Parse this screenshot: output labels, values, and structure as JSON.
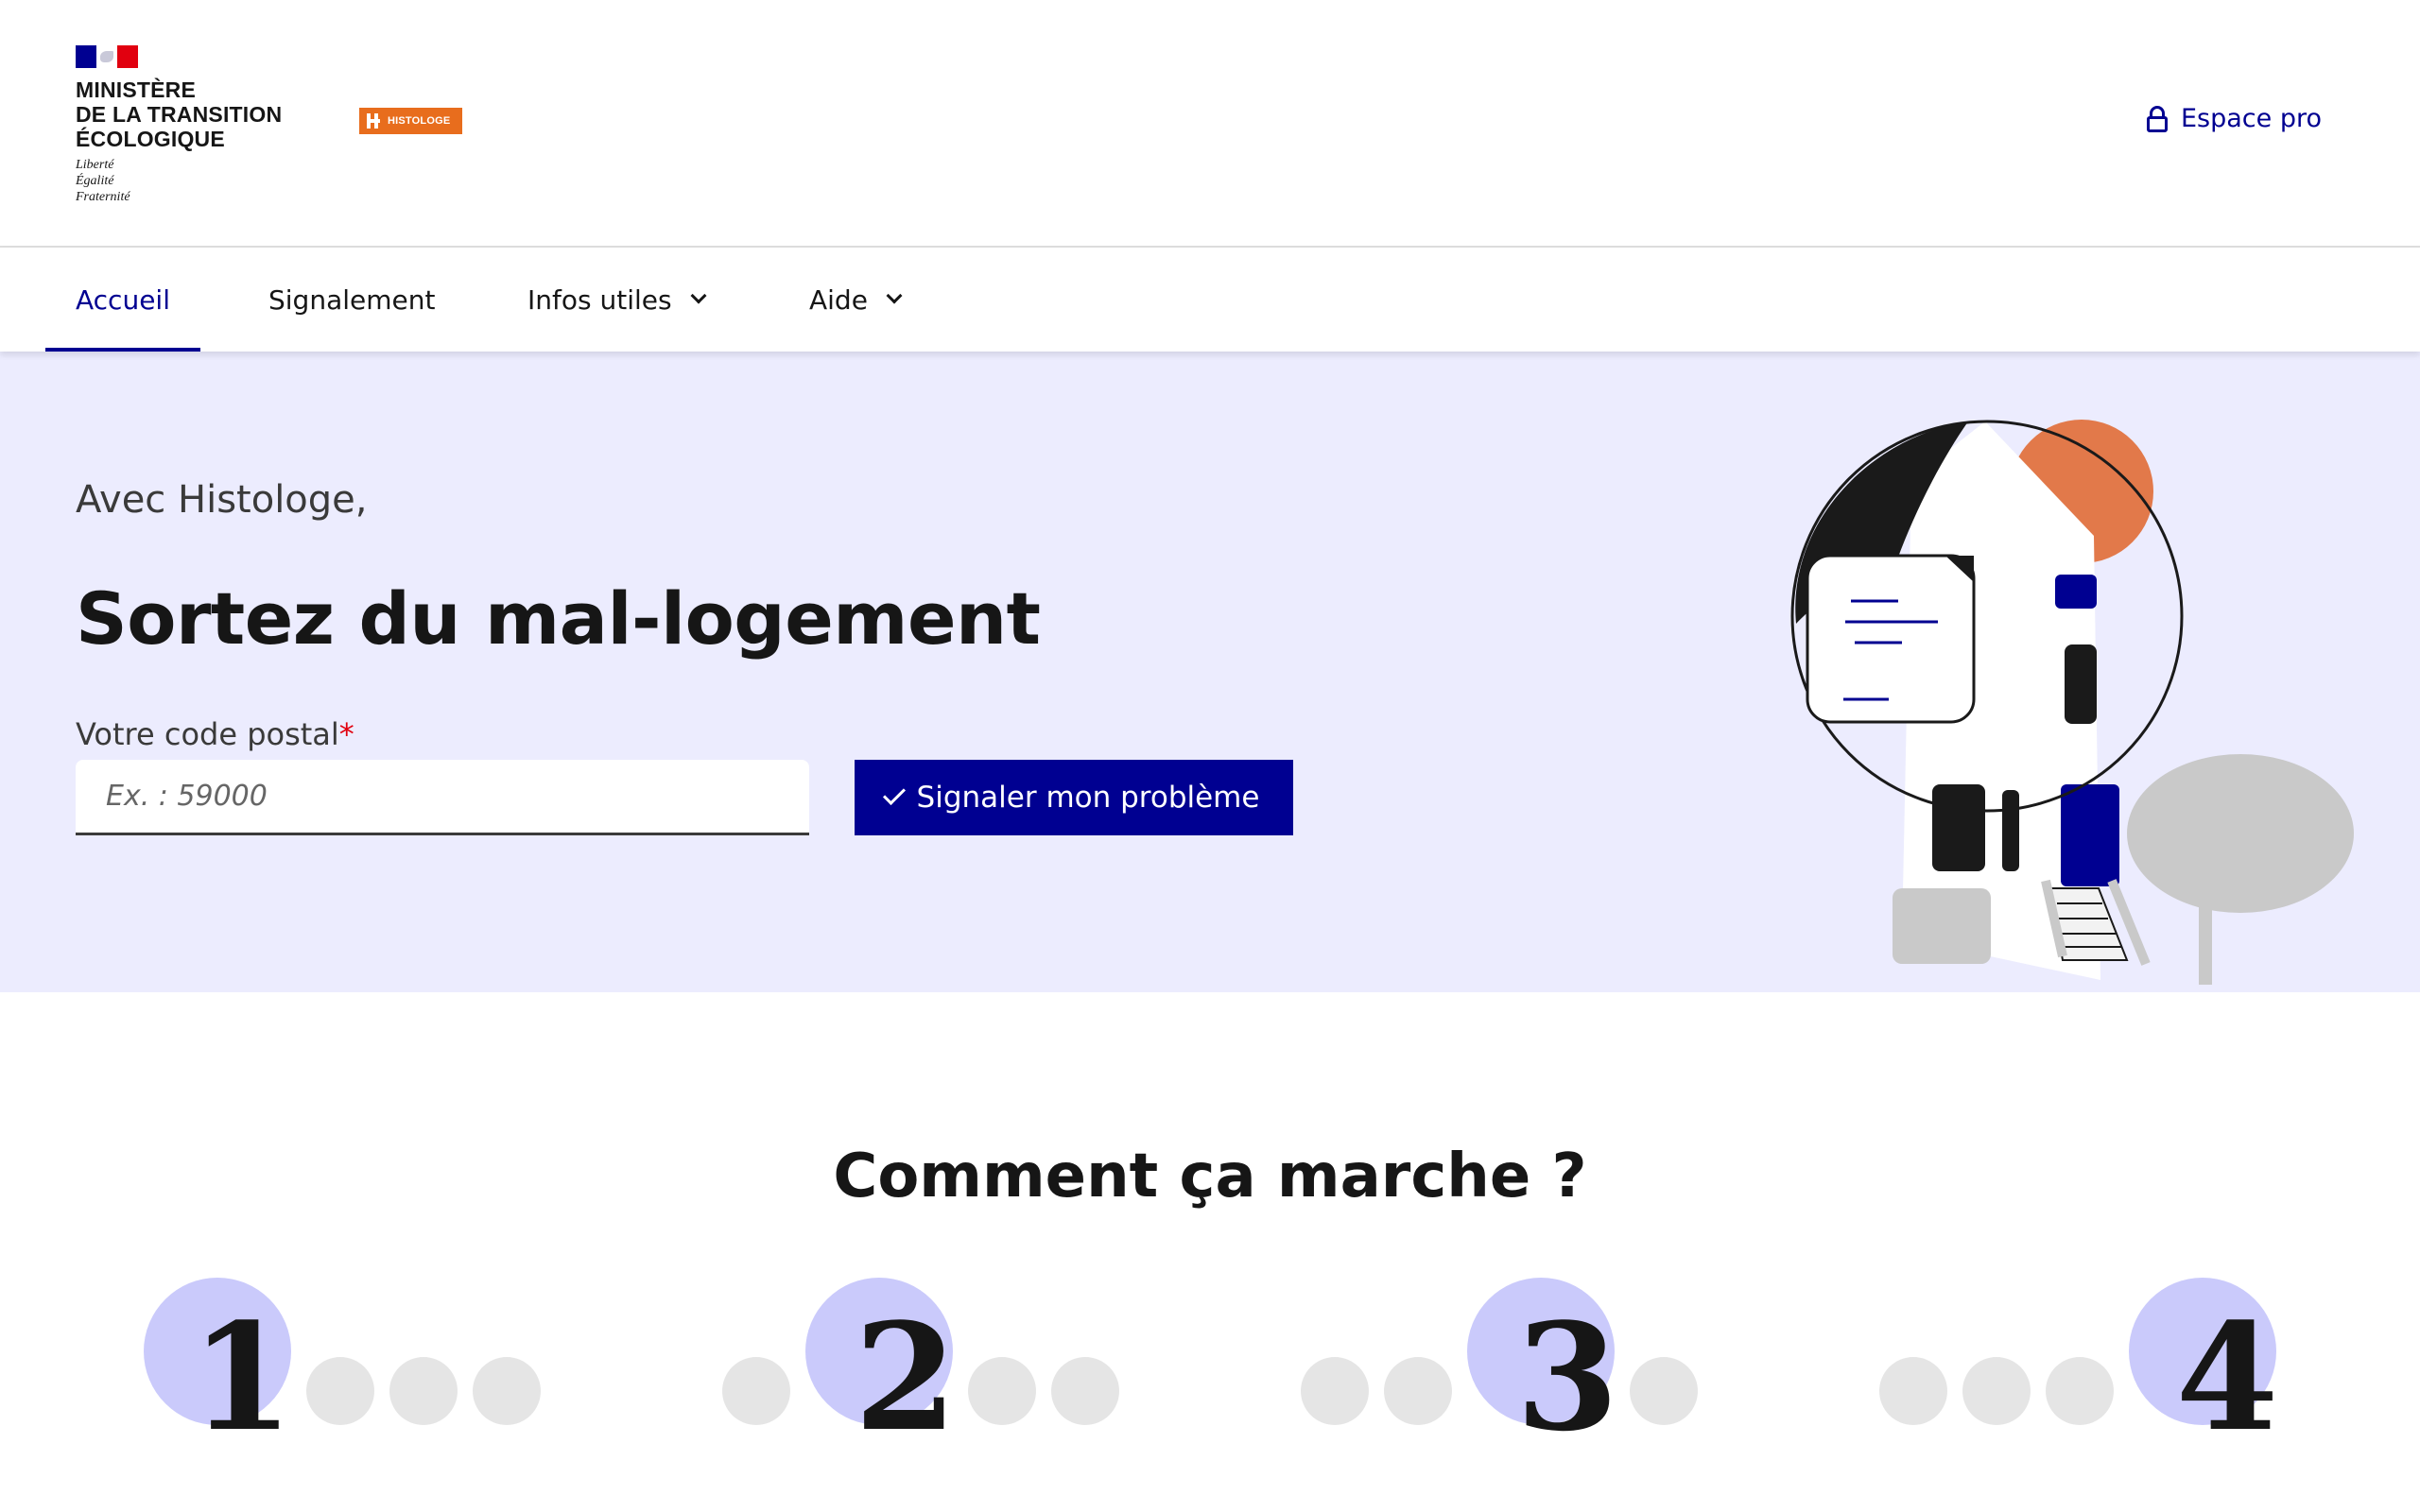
{
  "header": {
    "ministry_line1": "MINISTÈRE",
    "ministry_line2": "DE LA TRANSITION",
    "ministry_line3": "ÉCOLOGIQUE",
    "motto": [
      "Liberté",
      "Égalité",
      "Fraternité"
    ],
    "site_logo_text": "HISTOLOGE",
    "espace_pro_label": "Espace pro",
    "espace_pro_icon": "lock-icon"
  },
  "nav": {
    "items": [
      {
        "label": "Accueil",
        "active": true
      },
      {
        "label": "Signalement",
        "active": false
      },
      {
        "label": "Infos utiles",
        "dropdown": true
      },
      {
        "label": "Aide",
        "dropdown": true
      }
    ]
  },
  "hero": {
    "intro": "Avec Histologe,",
    "title": "Sortez du mal-logement",
    "postal_label": "Votre code postal",
    "required_mark": "*",
    "postal_placeholder": "Ex. : 59000",
    "postal_value": "",
    "submit_label": "Signaler mon problème",
    "submit_icon": "check-icon"
  },
  "how_it_works": {
    "title": "Comment ça marche ?",
    "steps": [
      "1",
      "2",
      "3",
      "4"
    ]
  },
  "colors": {
    "primary": "#000091",
    "hero_bg": "#ececfe",
    "step_circle": "#cacafb",
    "accent_orange": "#e86d1d",
    "required_red": "#e1000f"
  }
}
